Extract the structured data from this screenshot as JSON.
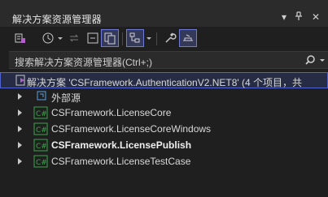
{
  "panel": {
    "title": "解决方案资源管理器",
    "controls": {
      "dropdown": "▾",
      "pin": "⊥",
      "close": "✕"
    }
  },
  "toolbar": {
    "buttons": [
      {
        "name": "switch-views-icon"
      },
      {
        "name": "pending-changes-icon"
      },
      {
        "name": "sync-with-document-icon"
      },
      {
        "name": "collapse-all-icon"
      },
      {
        "name": "show-all-files-icon",
        "active": true
      },
      {
        "name": "filter-icon",
        "active": true
      },
      {
        "name": "properties-wrench-icon"
      },
      {
        "name": "preview-selected-icon",
        "active": true
      }
    ]
  },
  "search": {
    "placeholder": "搜索解决方案资源管理器(Ctrl+;)"
  },
  "tree": {
    "solution": {
      "label": "解决方案 'CSFramework.AuthenticationV2.NET8' (4 个项目，共"
    },
    "items": [
      {
        "label": "外部源",
        "icon": "external-sources-icon",
        "bold": false
      },
      {
        "label": "CSFramework.LicenseCore",
        "icon": "csharp-project-icon",
        "bold": false
      },
      {
        "label": "CSFramework.LicenseCoreWindows",
        "icon": "csharp-project-icon",
        "bold": false
      },
      {
        "label": "CSFramework.LicensePublish",
        "icon": "csharp-project-icon",
        "bold": true
      },
      {
        "label": "CSFramework.LicenseTestCase",
        "icon": "csharp-project-icon",
        "bold": false
      }
    ]
  },
  "colors": {
    "background": "#1f1f1f",
    "accent": "#4f63d2",
    "csharp": "#3fa34d"
  }
}
